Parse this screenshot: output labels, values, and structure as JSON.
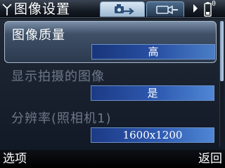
{
  "titlebar": {
    "title": "图像设置",
    "battery_label": "0",
    "icons": [
      "signal-icon",
      "camera-settings-tab-icon",
      "video-settings-tab-icon",
      "arrow-right-icon",
      "battery-icon"
    ]
  },
  "settings": [
    {
      "label": "图像质量",
      "value": "高",
      "selected": true
    },
    {
      "label": "显示拍摄的图像",
      "value": "是",
      "selected": false
    },
    {
      "label": "分辨率(照相机1)",
      "value": "1600x1200",
      "selected": false
    }
  ],
  "softkeys": {
    "left": "选项",
    "right": "返回"
  },
  "colors": {
    "accent": "#2f5bb2",
    "background": "#1a2230",
    "selected_highlight": "#3f5068"
  }
}
